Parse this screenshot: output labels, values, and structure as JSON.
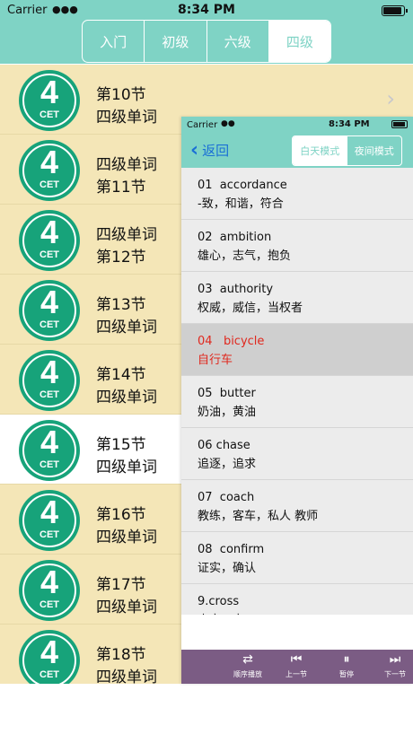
{
  "status_bar": {
    "carrier": "Carrier",
    "wifi_icon": "wifi-icon",
    "time": "8:34 PM",
    "battery_level": 0.95
  },
  "level_tabs": [
    {
      "label": "入门",
      "active": false
    },
    {
      "label": "初级",
      "active": false
    },
    {
      "label": "六级",
      "active": false
    },
    {
      "label": "四级",
      "active": true
    }
  ],
  "lessons": [
    {
      "badge_number": "4",
      "badge_text": "CET",
      "line1": "第10节",
      "line2": "四级单词",
      "selected": false
    },
    {
      "badge_number": "4",
      "badge_text": "CET",
      "line1": "四级单词",
      "line2": "第11节",
      "selected": false
    },
    {
      "badge_number": "4",
      "badge_text": "CET",
      "line1": "四级单词",
      "line2": "第12节",
      "selected": false
    },
    {
      "badge_number": "4",
      "badge_text": "CET",
      "line1": "第13节",
      "line2": "四级单词",
      "selected": false
    },
    {
      "badge_number": "4",
      "badge_text": "CET",
      "line1": "第14节",
      "line2": "四级单词",
      "selected": false
    },
    {
      "badge_number": "4",
      "badge_text": "CET",
      "line1": "第15节",
      "line2": "四级单词",
      "selected": true
    },
    {
      "badge_number": "4",
      "badge_text": "CET",
      "line1": "第16节",
      "line2": "四级单词",
      "selected": false
    },
    {
      "badge_number": "4",
      "badge_text": "CET",
      "line1": "第17节",
      "line2": "四级单词",
      "selected": false
    },
    {
      "badge_number": "4",
      "badge_text": "CET",
      "line1": "第18节",
      "line2": "四级单词",
      "selected": false
    }
  ],
  "detail": {
    "status_bar": {
      "carrier": "Carrier",
      "time": "8:34 PM"
    },
    "back_label": "返回",
    "modes": [
      {
        "label": "白天模式",
        "active": true
      },
      {
        "label": "夜间模式",
        "active": false
      }
    ],
    "words": [
      {
        "en": "01  accordance",
        "zh": "-致，和谐，符合",
        "active": false
      },
      {
        "en": "02  ambition",
        "zh": "雄心，志气，抱负",
        "active": false
      },
      {
        "en": "03  authority",
        "zh": "权威，威信，当权者",
        "active": false
      },
      {
        "en": "04   bicycle",
        "zh": "自行车",
        "active": true
      },
      {
        "en": "05  butter",
        "zh": "奶油，黄油",
        "active": false
      },
      {
        "en": "06 chase",
        "zh": "追逐，追求",
        "active": false
      },
      {
        "en": "07  coach",
        "zh": "教练，客车，私人 教师",
        "active": false
      },
      {
        "en": "08  confirm",
        "zh": "证实，确认",
        "active": false
      },
      {
        "en": "9.cross",
        "zh": "十字，交叉",
        "active": false
      }
    ],
    "player": [
      {
        "icon": "shuffle-icon",
        "glyph": "⇄",
        "label": "顺序播放"
      },
      {
        "icon": "previous-icon",
        "glyph": "⏮",
        "label": "上一节"
      },
      {
        "icon": "pause-icon",
        "glyph": "⏸",
        "label": "暂停"
      },
      {
        "icon": "next-icon",
        "glyph": "⏭",
        "label": "下一节"
      }
    ]
  },
  "colors": {
    "teal": "#7fd3c5",
    "cream": "#f4e6b7",
    "badge_green": "#17a37a",
    "player_purple": "#7b5c84",
    "highlight_red": "#e0281e",
    "link_blue": "#1a6fd6"
  }
}
